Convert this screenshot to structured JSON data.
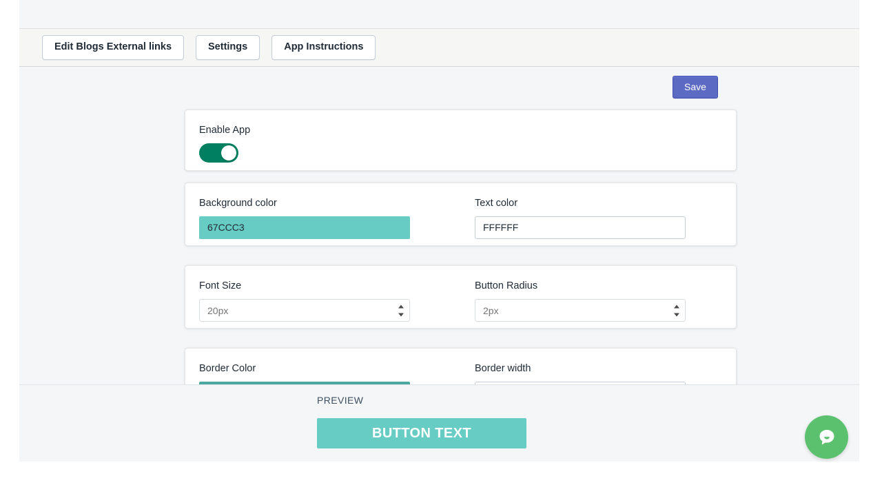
{
  "toolbar": {
    "tabs": [
      {
        "label": "Edit Blogs External links",
        "name": "tab-edit-blogs-external-links"
      },
      {
        "label": "Settings",
        "name": "tab-settings"
      },
      {
        "label": "App Instructions",
        "name": "tab-app-instructions"
      }
    ]
  },
  "actions": {
    "save_label": "Save",
    "save_color": "#5c6ac4"
  },
  "settings": {
    "enable_app": {
      "label": "Enable App",
      "checked": true,
      "toggle_color": "#008060"
    },
    "background_color": {
      "label": "Background color",
      "value": "67CCC3",
      "swatch": "#67CCC3"
    },
    "text_color": {
      "label": "Text color",
      "value": "FFFFFF",
      "swatch": "#FFFFFF"
    },
    "font_size": {
      "label": "Font Size",
      "value": "20px",
      "placeholder": "20px"
    },
    "button_radius": {
      "label": "Button Radius",
      "value": "2px",
      "placeholder": "2px"
    },
    "border_color": {
      "label": "Border Color",
      "value": "",
      "swatch": "#4BA8A0"
    },
    "border_width": {
      "label": "Border width",
      "value": ""
    }
  },
  "preview": {
    "label": "PREVIEW",
    "button_text": "BUTTON TEXT",
    "button_bg": "#67CCC3",
    "button_fg": "#FFFFFF"
  },
  "chat": {
    "launcher_name": "chat-launcher",
    "color": "#5cc16f"
  }
}
